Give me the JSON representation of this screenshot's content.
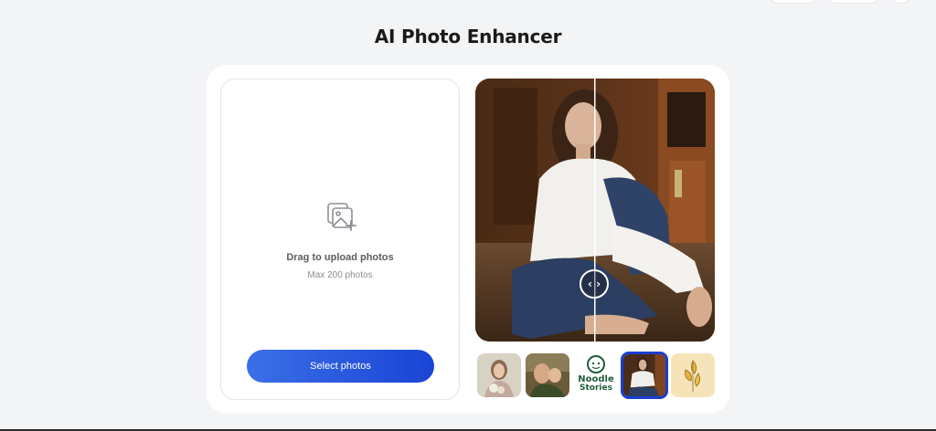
{
  "page": {
    "title": "AI Photo Enhancer"
  },
  "upload": {
    "title": "Drag to upload photos",
    "subtitle": "Max 200 photos",
    "button_label": "Select photos",
    "icon": "image-upload-icon"
  },
  "compare": {
    "handle_icon": "left-right-arrows-icon",
    "handle_glyph": "‹ ›"
  },
  "samples": [
    {
      "name": "girl-with-flowers"
    },
    {
      "name": "father-and-child"
    },
    {
      "name": "noodle-stories-logo",
      "title": "Noodle",
      "title2": "Stories"
    },
    {
      "name": "woman-sitting-portrait",
      "selected": true
    },
    {
      "name": "yellow-leaf-sketch"
    }
  ],
  "colors": {
    "accent": "#1a44d6",
    "accent_start": "#3b6fe6",
    "selected_border": "#1a3ed3"
  }
}
